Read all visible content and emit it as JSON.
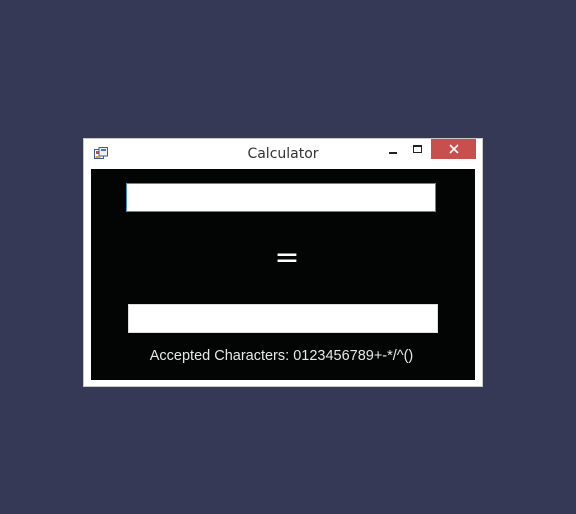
{
  "window": {
    "title": "Calculator"
  },
  "calculator": {
    "expression_value": "",
    "equals_sign": "=",
    "result_value": "",
    "accepted_characters_text": "Accepted Characters: 0123456789+-*/^()"
  },
  "icons": {
    "app": "app-icon",
    "minimize": "minimize-icon",
    "maximize": "maximize-icon",
    "close": "close-icon"
  },
  "colors": {
    "desktop": "#363955",
    "client_background": "#030404",
    "close_button": "#c7504f",
    "input_focus_border": "#3c8fd6",
    "text_light": "#e8e8e8"
  }
}
